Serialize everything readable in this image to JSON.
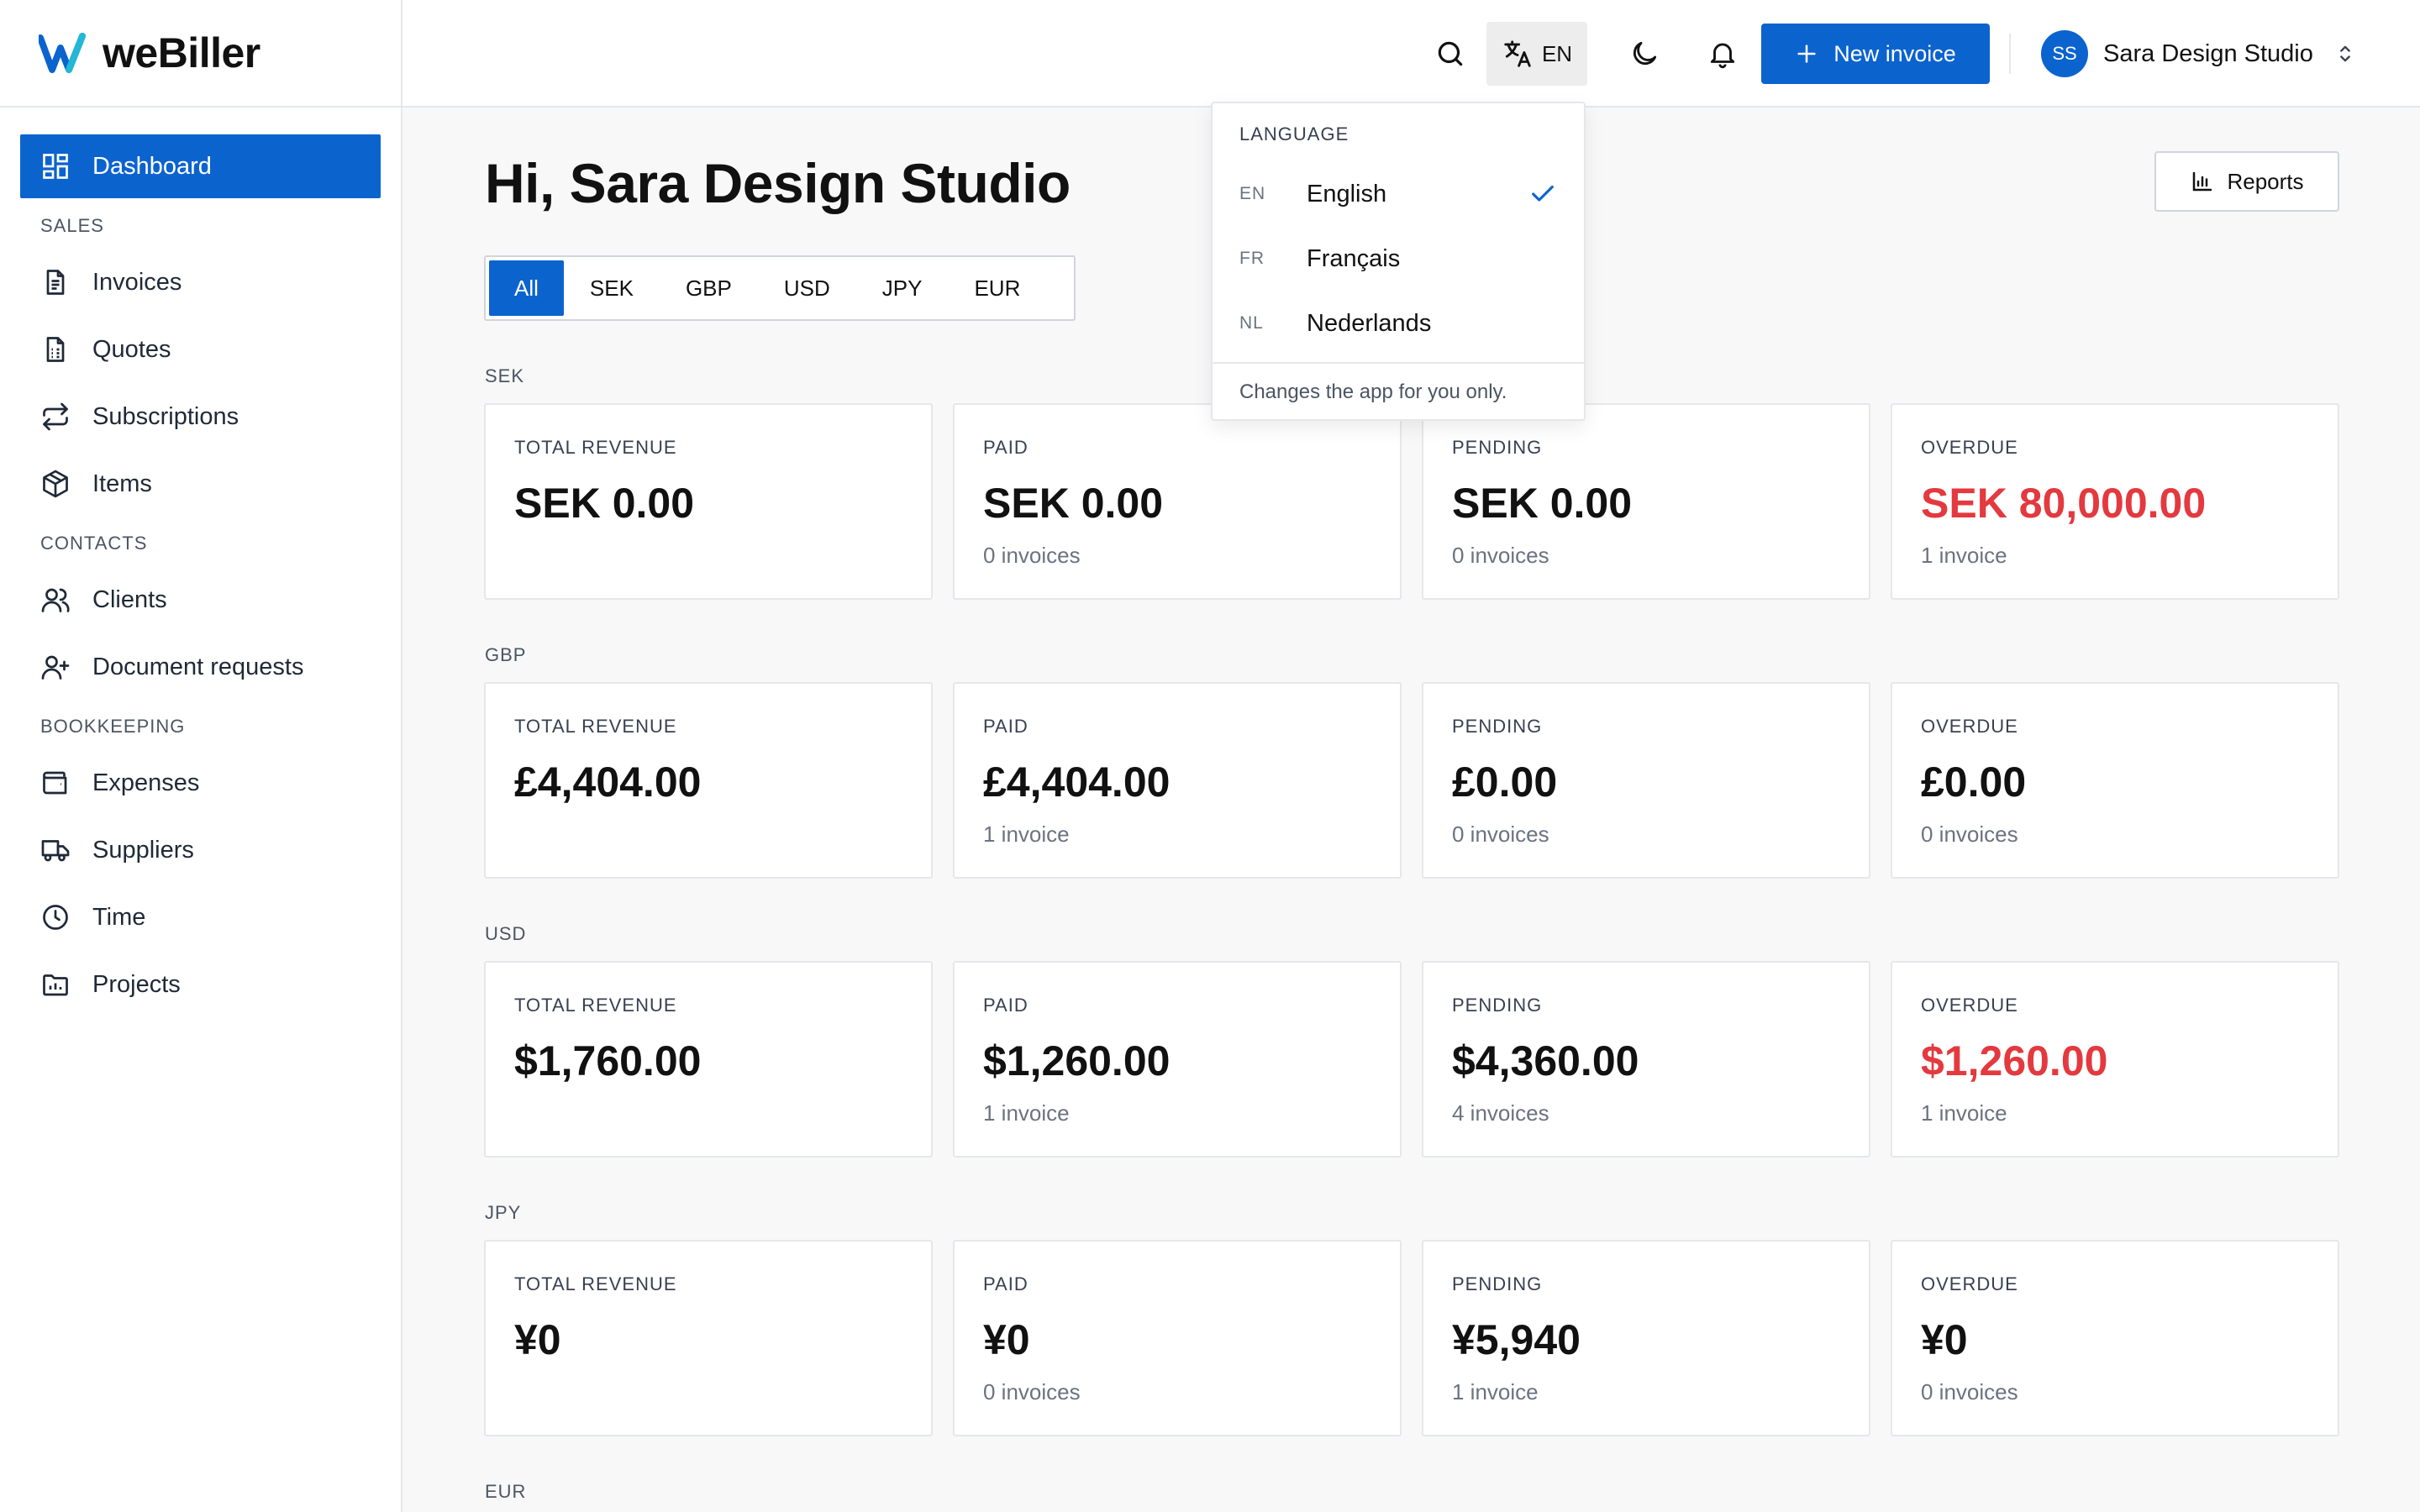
{
  "brand": {
    "name": "weBiller",
    "accent": "#0b63ce",
    "danger": "#e3393f"
  },
  "sidebar": {
    "dashboard": "Dashboard",
    "sections": {
      "sales": "SALES",
      "contacts": "CONTACTS",
      "bookkeeping": "BOOKKEEPING"
    },
    "items": {
      "invoices": "Invoices",
      "quotes": "Quotes",
      "subscriptions": "Subscriptions",
      "items": "Items",
      "clients": "Clients",
      "document_requests": "Document requests",
      "expenses": "Expenses",
      "suppliers": "Suppliers",
      "time": "Time",
      "projects": "Projects"
    }
  },
  "topbar": {
    "language_code": "EN",
    "new_invoice": "New invoice",
    "avatar_initials": "SS",
    "account_name": "Sara Design Studio"
  },
  "language_menu": {
    "title": "LANGUAGE",
    "options": [
      {
        "code": "EN",
        "name": "English",
        "selected": true
      },
      {
        "code": "FR",
        "name": "Français",
        "selected": false
      },
      {
        "code": "NL",
        "name": "Nederlands",
        "selected": false
      }
    ],
    "note": "Changes the app for you only."
  },
  "main": {
    "greeting": "Hi, Sara Design Studio",
    "reports": "Reports",
    "tabs": [
      "All",
      "SEK",
      "GBP",
      "USD",
      "JPY",
      "EUR"
    ],
    "active_tab": "All",
    "card_labels": {
      "total": "TOTAL REVENUE",
      "paid": "PAID",
      "pending": "PENDING",
      "overdue": "OVERDUE"
    },
    "currencies": [
      {
        "code": "SEK",
        "total": "SEK 0.00",
        "paid": "SEK 0.00",
        "paid_count": "0 invoices",
        "pending": "SEK 0.00",
        "pending_count": "0 invoices",
        "overdue": "SEK 80,000.00",
        "overdue_count": "1 invoice"
      },
      {
        "code": "GBP",
        "total": "£4,404.00",
        "paid": "£4,404.00",
        "paid_count": "1 invoice",
        "pending": "£0.00",
        "pending_count": "0 invoices",
        "overdue": "£0.00",
        "overdue_count": "0 invoices"
      },
      {
        "code": "USD",
        "total": "$1,760.00",
        "paid": "$1,260.00",
        "paid_count": "1 invoice",
        "pending": "$4,360.00",
        "pending_count": "4 invoices",
        "overdue": "$1,260.00",
        "overdue_count": "1 invoice"
      },
      {
        "code": "JPY",
        "total": "¥0",
        "paid": "¥0",
        "paid_count": "0 invoices",
        "pending": "¥5,940",
        "pending_count": "1 invoice",
        "overdue": "¥0",
        "overdue_count": "0 invoices"
      }
    ],
    "eur_label": "EUR"
  }
}
